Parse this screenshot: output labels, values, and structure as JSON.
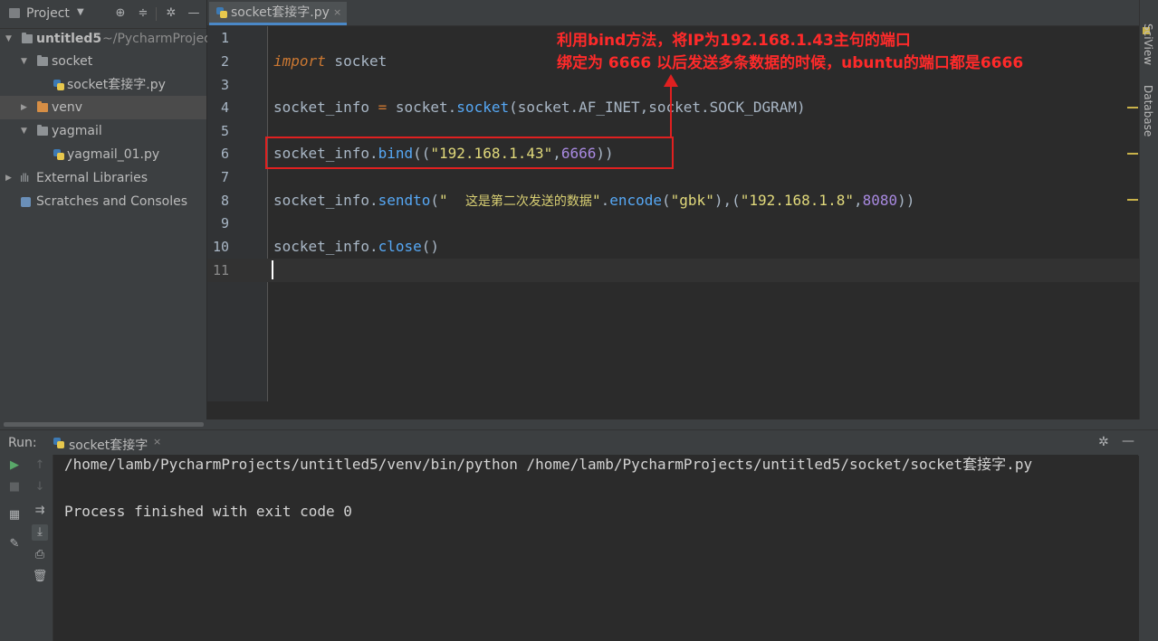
{
  "project_panel": {
    "title": "Project",
    "tree": [
      {
        "label": "untitled5",
        "path": "~/PycharmProjec"
      },
      {
        "label": "socket"
      },
      {
        "label": "socket套接字.py"
      },
      {
        "label": "venv"
      },
      {
        "label": "yagmail"
      },
      {
        "label": "yagmail_01.py"
      },
      {
        "label": "External Libraries"
      },
      {
        "label": "Scratches and Consoles"
      }
    ]
  },
  "editor": {
    "tab_label": "socket套接字.py",
    "line_numbers": [
      "1",
      "2",
      "3",
      "4",
      "5",
      "6",
      "7",
      "8",
      "9",
      "10",
      "11"
    ],
    "code": {
      "l2_kw": "import",
      "l2_rest": " socket",
      "l4_a": "socket_info ",
      "l4_eq": "=",
      "l4_b": " socket.",
      "l4_fn": "socket",
      "l4_c": "(socket.AF_INET,socket.SOCK_DGRAM)",
      "l6_a": "socket_info.",
      "l6_fn": "bind",
      "l6_b": "((",
      "l6_str": "\"192.168.1.43\"",
      "l6_c": ",",
      "l6_num": "6666",
      "l6_d": "))",
      "l8_a": "socket_info.",
      "l8_fn": "sendto",
      "l8_b": "(",
      "l8_q1": "\"  ",
      "l8_cjk": "这是第二次发送的数据",
      "l8_q2": "\"",
      "l8_c": ".",
      "l8_fn2": "encode",
      "l8_d": "(",
      "l8_str2": "\"gbk\"",
      "l8_e": "),(",
      "l8_str3": "\"192.168.1.8\"",
      "l8_f": ",",
      "l8_num": "8080",
      "l8_g": "))",
      "l10_a": "socket_info.",
      "l10_fn": "close",
      "l10_b": "()"
    },
    "annotation_line1": "利用bind方法，将IP为192.168.1.43主句的端口",
    "annotation_line2": "绑定为 6666 以后发送多条数据的时候，ubuntu的端口都是6666",
    "right_tabs": [
      "SciView",
      "Database"
    ]
  },
  "run_panel": {
    "label": "Run:",
    "tab_label": "socket套接字",
    "output": [
      "/home/lamb/PycharmProjects/untitled5/venv/bin/python /home/lamb/PycharmProjects/untitled5/socket/socket套接字.py",
      "",
      "Process finished with exit code 0"
    ]
  },
  "colors": {
    "editor_bg": "#2b2b2b",
    "panel_bg": "#3c3f41",
    "keyword": "#cc7832",
    "function": "#56a8f5",
    "string": "#e1d97b",
    "number": "#a889e0",
    "annotation": "#ff2a2a"
  },
  "icons": [
    "folder-icon",
    "python-file-icon",
    "libraries-icon",
    "scratches-icon",
    "gear-icon",
    "collapse-icon",
    "locate-icon",
    "minimize-icon",
    "run-icon",
    "stop-icon",
    "up-arrow-icon",
    "down-arrow-icon",
    "soft-wrap-icon",
    "scroll-to-end-icon",
    "print-icon",
    "trash-icon",
    "pin-icon",
    "layout-icon"
  ]
}
